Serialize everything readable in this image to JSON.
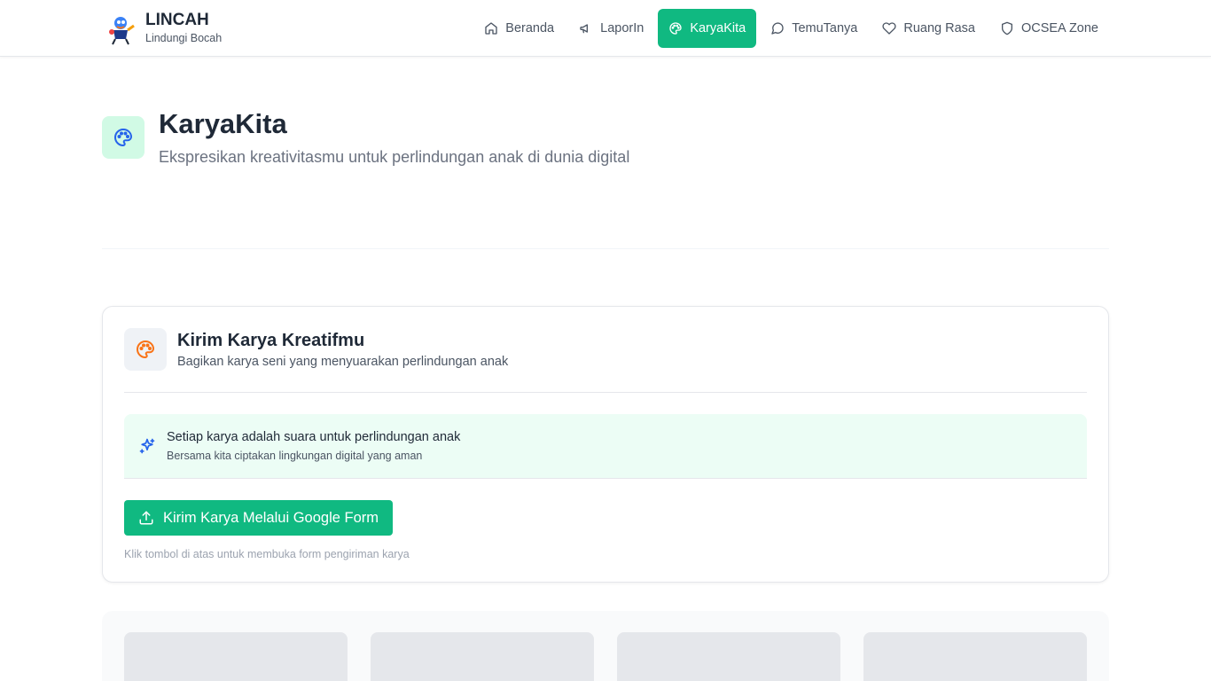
{
  "header": {
    "brand_title": "LINCAH",
    "brand_subtitle": "Lindungi Bocah",
    "nav": [
      {
        "label": "Beranda",
        "icon": "home-icon",
        "active": false
      },
      {
        "label": "LaporIn",
        "icon": "megaphone-icon",
        "active": false
      },
      {
        "label": "KaryaKita",
        "icon": "palette-icon",
        "active": true
      },
      {
        "label": "TemuTanya",
        "icon": "message-circle-icon",
        "active": false
      },
      {
        "label": "Ruang Rasa",
        "icon": "heart-icon",
        "active": false
      },
      {
        "label": "OCSEA Zone",
        "icon": "shield-icon",
        "active": false
      }
    ]
  },
  "hero": {
    "title": "KaryaKita",
    "subtitle": "Ekspresikan kreativitasmu untuk perlindungan anak di dunia digital",
    "icon": "palette-icon"
  },
  "card": {
    "title": "Kirim Karya Kreatifmu",
    "subtitle": "Bagikan karya seni yang menyuarakan perlindungan anak",
    "icon": "palette-icon",
    "info_title": "Setiap karya adalah suara untuk perlindungan anak",
    "info_subtitle": "Bersama kita ciptakan lingkungan digital yang aman",
    "info_icon": "sparkles-icon",
    "cta_label": "Kirim Karya Melalui Google Form",
    "cta_icon": "upload-icon",
    "cta_note": "Klik tombol di atas untuk membuka form pengiriman karya"
  },
  "colors": {
    "accent": "#10b981",
    "hero_icon_bg": "#d1fae5",
    "info_bg": "#ecfdf5"
  }
}
